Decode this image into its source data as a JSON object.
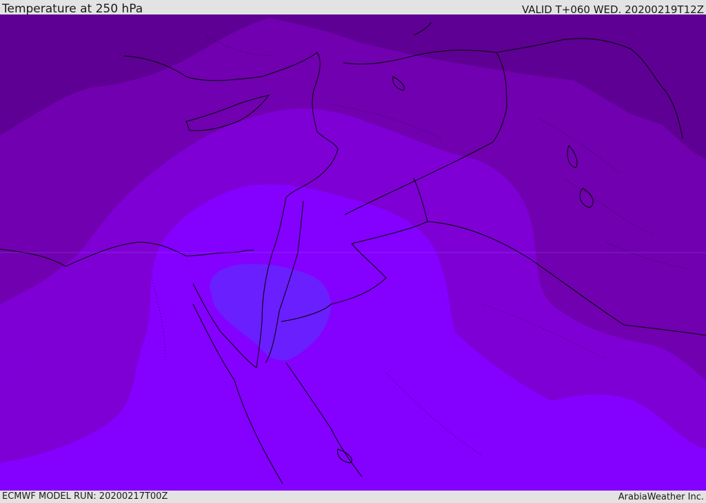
{
  "header": {
    "title": "Temperature at 250 hPa",
    "valid": "VALID T+060 WED. 20200219T12Z"
  },
  "footer": {
    "model_run": "ECMWF MODEL RUN: 20200217T00Z",
    "credit": "ArabiaWeather Inc."
  },
  "colors": {
    "band_coldest": "#5e0094",
    "band_cold": "#7100b0",
    "band_mid": "#7f00d5",
    "band_warm": "#8400ff",
    "band_warmest": "#6a1fff",
    "coastline": "#000000",
    "background": "#e3e3e3"
  }
}
